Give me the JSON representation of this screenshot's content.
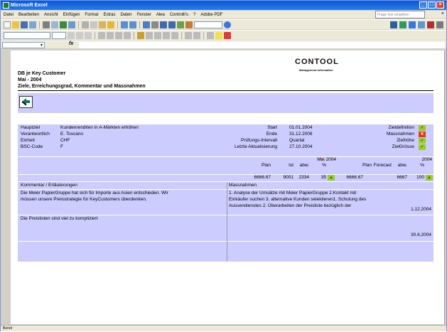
{
  "window": {
    "title": "Microsoft Excel"
  },
  "menu": {
    "items": [
      "Datei",
      "Bearbeiten",
      "Ansicht",
      "Einfügen",
      "Format",
      "Extras",
      "Daten",
      "Fenster",
      "Alea",
      "Controlli's",
      "?",
      "Adobe PDF"
    ],
    "help_placeholder": "Frage hier eingeben"
  },
  "formula_bar": {
    "fx": "fx"
  },
  "status_bar": {
    "text": "Bereit"
  },
  "report": {
    "title_line1": "DB je Key Customer",
    "title_line2": "Mai - 2004",
    "title_line3": "Ziele, Erreichungsgrad, Kommentar und Massnahmen",
    "brand": "CONTOOL",
    "brand_sub": "Management Information"
  },
  "info": {
    "labels": [
      "Hauptziel",
      "Verantwortlich",
      "Einheit",
      "BSC-Code"
    ],
    "values": [
      "Kundenrenditen in A-Märkten erhöhen",
      "E. Toscano",
      "CHF",
      "F"
    ],
    "mid_labels": [
      "Start",
      "Ende",
      "Prüfungs-Intervall",
      "Letzte Aktualisierung"
    ],
    "mid_values": [
      "01.01.2004",
      "31.12.2006",
      "Quartal",
      "27.10.2004"
    ],
    "status_labels": [
      "Zieldefinition",
      "Massnahmen",
      "Zielhöhe",
      "ZielGrösse"
    ],
    "status_marks": [
      "✓",
      "✕",
      "✓",
      "✓"
    ]
  },
  "kpi": {
    "period_label": "Mai 2004",
    "year_label": "2004",
    "headers": [
      "Plan",
      "Ist",
      "abw.",
      "%",
      "Plan",
      "Forecast",
      "abw.",
      "%"
    ],
    "values": [
      "6666.67",
      "9001",
      "2334",
      "35",
      "6666.67",
      "",
      "6667",
      "100"
    ]
  },
  "comments": {
    "left_header": "Kommentar / Erläuterungen",
    "right_header": "Massnahmen",
    "left_1": "Die Meier PapierGruppe hat sich für Importe aus Asien entschieden. Wir",
    "left_2": "müssen unsere Preisstrategie für KeyCustomers überdenken.",
    "right_1": "1. Analyse der Umsätze mit Meier PapierGruppe 2.Kontakt mit",
    "right_2": "Einkäufer suchen 3. alternative Kunden selektieren1. Schulung des",
    "right_3": "Aussendienstes 2. Überarbeiten der Preisliste bezüglich der",
    "date_1": "1.12.2004",
    "left_3": "Die Preislisten sind viel zu kompliziert",
    "date_2": "30.6.2004"
  }
}
